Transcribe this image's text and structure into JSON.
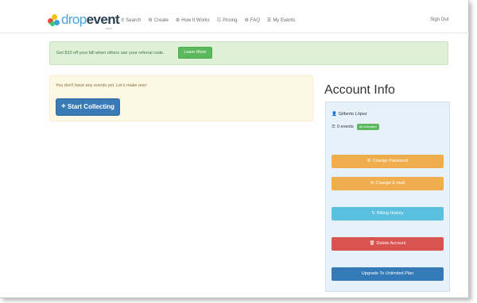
{
  "navbar": {
    "logo": {
      "part1": "drop",
      "part2": "event",
      "sub": ".com"
    },
    "links": [
      {
        "icon": "search-icon",
        "glyph": "⚲",
        "label": "Search"
      },
      {
        "icon": "gear-icon",
        "glyph": "⚙",
        "label": "Create"
      },
      {
        "icon": "gear-icon",
        "glyph": "⚙",
        "label": "How It Works"
      },
      {
        "icon": "table-icon",
        "glyph": "☷",
        "label": "Pricing"
      },
      {
        "icon": "gear-icon",
        "glyph": "⚙",
        "label": "FAQ"
      },
      {
        "icon": "list-icon",
        "glyph": "☰",
        "label": "My Events"
      }
    ],
    "signout": "Sign Out"
  },
  "banner": {
    "text": "Get $10 off your bill when others use your referral code.",
    "button": "Learn More"
  },
  "alert": {
    "text": "You don't have any events yet. Let's make one!",
    "button": "Start Collecting"
  },
  "account": {
    "title": "Account Info",
    "user_name": "Gilberto López",
    "events_count": "0 events",
    "status_badge": "All Activated",
    "buttons": {
      "change_password": "Change Password",
      "change_email": "Change E-mail",
      "billing_history": "Billing History",
      "delete_account": "Delete Account",
      "upgrade": "Upgrade To Unlimited Plan"
    }
  },
  "colors": {
    "accent_blue": "#3a7ab7",
    "success": "#5cb85c",
    "warning": "#f0ad4e",
    "info": "#5bc0de",
    "danger": "#d9534f"
  }
}
